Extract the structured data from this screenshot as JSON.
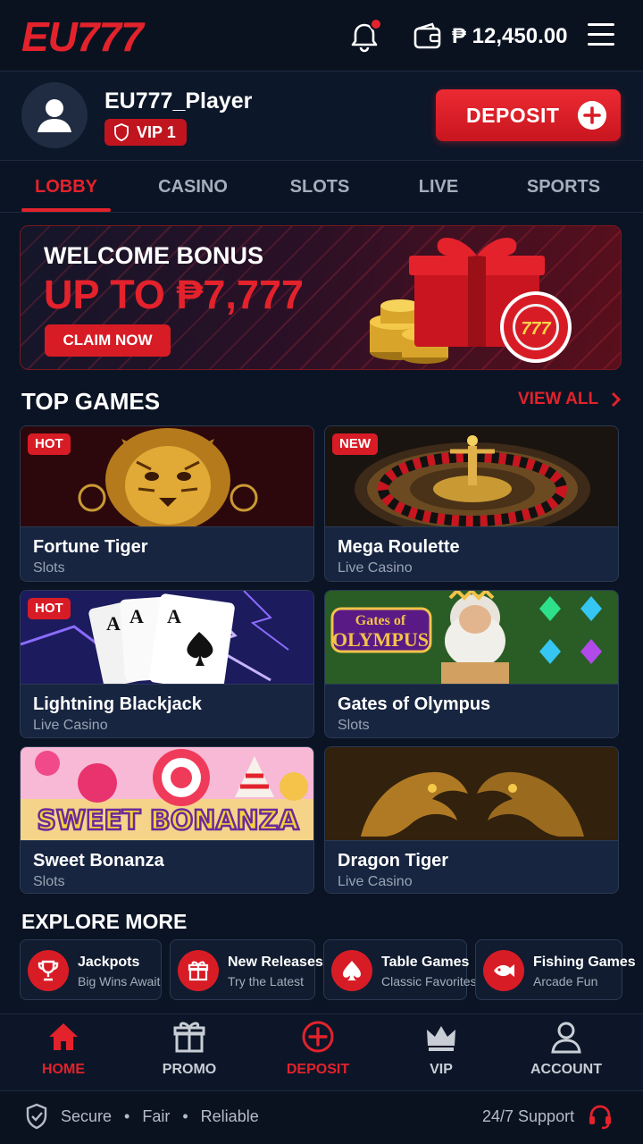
{
  "colors": {
    "accent": "#e3222c",
    "background": "#0b1424",
    "card": "#172540"
  },
  "header": {
    "logo": "EU777",
    "balance": "₱ 12,450.00",
    "icons": [
      "bell-icon",
      "wallet-icon",
      "menu-icon"
    ]
  },
  "user": {
    "name": "EU777_Player",
    "vip": "VIP 1",
    "deposit_label": "DEPOSIT"
  },
  "tabs": [
    "LOBBY",
    "CASINO",
    "SLOTS",
    "LIVE",
    "SPORTS"
  ],
  "active_tab": "LOBBY",
  "banner": {
    "title": "WELCOME BONUS",
    "amount": "UP TO ₱7,777",
    "cta": "CLAIM NOW",
    "chip_text": "777"
  },
  "top_games": {
    "title": "TOP GAMES",
    "view_all": "VIEW ALL",
    "games": [
      {
        "name": "Fortune Tiger",
        "category": "Slots",
        "tag": "HOT"
      },
      {
        "name": "Mega Roulette",
        "category": "Live Casino",
        "tag": "NEW"
      },
      {
        "name": "Lightning Blackjack",
        "category": "Live Casino",
        "tag": "HOT"
      },
      {
        "name": "Gates of Olympus",
        "category": "Slots",
        "tag": "",
        "art_title_1": "Gates of",
        "art_title_2": "OLYMPUS"
      },
      {
        "name": "Sweet Bonanza",
        "category": "Slots",
        "tag": "",
        "art_title": "SWEET BONANZA"
      },
      {
        "name": "Dragon Tiger",
        "category": "Live Casino",
        "tag": ""
      }
    ]
  },
  "explore": {
    "title": "EXPLORE MORE",
    "items": [
      {
        "name": "Jackpots",
        "sub": "Big Wins Await",
        "icon": "trophy-icon"
      },
      {
        "name": "New Releases",
        "sub": "Try the Latest",
        "icon": "gift-icon"
      },
      {
        "name": "Table Games",
        "sub": "Classic Favorites",
        "icon": "spade-icon"
      },
      {
        "name": "Fishing Games",
        "sub": "Arcade Fun",
        "icon": "fish-icon"
      }
    ]
  },
  "bottom_nav": [
    {
      "label": "HOME",
      "icon": "home-icon",
      "active": true
    },
    {
      "label": "PROMO",
      "icon": "gift-icon",
      "active": false
    },
    {
      "label": "DEPOSIT",
      "icon": "plus-circle-icon",
      "active": false
    },
    {
      "label": "VIP",
      "icon": "crown-icon",
      "active": false
    },
    {
      "label": "ACCOUNT",
      "icon": "user-icon",
      "active": false
    }
  ],
  "footer": {
    "secure": "Secure",
    "fair": "Fair",
    "reliable": "Reliable",
    "support": "24/7 Support"
  }
}
